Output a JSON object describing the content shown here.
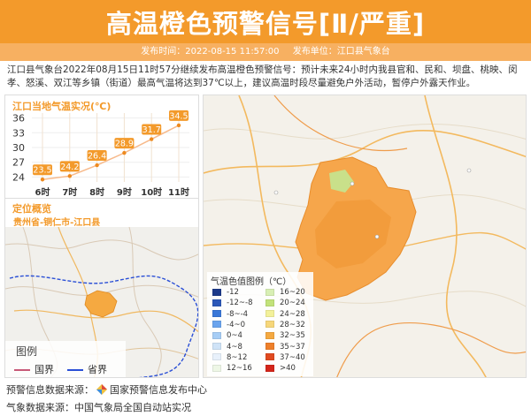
{
  "header": {
    "title": "高温橙色预警信号[Ⅱ/严重]",
    "publish_time": "发布时间：2022-08-15 11:57:00",
    "publish_unit": "发布单位：江口县气象台"
  },
  "warning_text": "江口县气象台2022年08月15日11时57分继续发布高温橙色预警信号：预计未来24小时内我县官和、民和、坝盘、桃映、闵孝、怒溪、双江等乡镇（街道）最高气温将达到37℃以上，建议高温时段尽量避免户外活动，暂停户外露天作业。",
  "temp_panel": {
    "title": "江口当地气温实况(℃)"
  },
  "chart_data": {
    "type": "line",
    "categories": [
      "6时",
      "7时",
      "8时",
      "9时",
      "10时",
      "11时"
    ],
    "values": [
      23.5,
      24.2,
      26.4,
      28.9,
      31.7,
      34.5
    ],
    "yticks": [
      24,
      27,
      30,
      33,
      36
    ],
    "ylim": [
      23,
      37
    ],
    "colors": {
      "line": "#f7b98a",
      "marker": "#ee8a1f",
      "label": "#f39a2b"
    }
  },
  "location_panel": {
    "title": "定位概览",
    "name": "贵州省-铜仁市-江口县",
    "legend_title": "图例",
    "legend_items": [
      {
        "label": "国界",
        "color": "#c85a78"
      },
      {
        "label": "省界",
        "color": "#2a4fd6"
      }
    ]
  },
  "map_legend": {
    "title": "气温色值图例（℃）",
    "items": [
      {
        "label": "-12",
        "color": "#1d3a8a"
      },
      {
        "label": "-12~-8",
        "color": "#2c58b8"
      },
      {
        "label": "-8~-4",
        "color": "#3a78d8"
      },
      {
        "label": "-4~0",
        "color": "#6aa4ee"
      },
      {
        "label": "0~4",
        "color": "#a6cdf5"
      },
      {
        "label": "4~8",
        "color": "#cfe3f7"
      },
      {
        "label": "8~12",
        "color": "#e8f1fb"
      },
      {
        "label": "12~16",
        "color": "#eef7e6"
      },
      {
        "label": "16~20",
        "color": "#d8efb4"
      },
      {
        "label": "20~24",
        "color": "#c2e27a"
      },
      {
        "label": "24~28",
        "color": "#f3f19a"
      },
      {
        "label": "28~32",
        "color": "#f7d77a"
      },
      {
        "label": "32~35",
        "color": "#f5a941"
      },
      {
        "label": "35~37",
        "color": "#ee7f2a"
      },
      {
        "label": "37~40",
        "color": "#e04a20"
      },
      {
        "label": ">40",
        "color": "#d4251a"
      }
    ]
  },
  "footer": {
    "warning_source_label": "预警信息数据来源：",
    "warning_source": "国家预警信息发布中心",
    "weather_source": "气象数据来源：中国气象局全国自动站实况"
  },
  "colors": {
    "banner": "#f39a2b",
    "meta_bar": "#f7b061",
    "warning_area": "#f5a941"
  }
}
